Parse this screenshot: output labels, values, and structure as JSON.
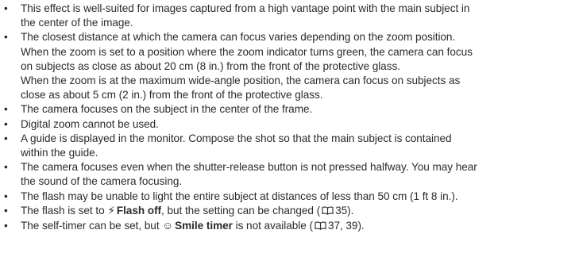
{
  "items": [
    {
      "lines": [
        "This effect is well-suited for images captured from a high vantage point with the main subject in",
        "the center of the image."
      ]
    },
    {
      "lines": [
        "The closest distance at which the camera can focus varies depending on the zoom position.",
        "When the zoom is set to a position where the zoom indicator turns green, the camera can focus",
        "on subjects as close as about 20 cm (8 in.) from the front of the protective glass.",
        "When the zoom is at the maximum wide-angle position, the camera can focus on subjects as",
        "close as about 5 cm (2 in.) from the front of the protective glass."
      ]
    },
    {
      "lines": [
        "The camera focuses on the subject in the center of the frame."
      ]
    },
    {
      "lines": [
        "Digital zoom cannot be used."
      ]
    },
    {
      "lines": [
        "A guide is displayed in the monitor. Compose the shot so that the main subject is contained",
        "within the guide."
      ]
    },
    {
      "lines": [
        "The camera focuses even when the shutter-release button is not pressed halfway. You may hear",
        "the sound of the camera focusing."
      ]
    },
    {
      "lines": [
        "The flash may be unable to light the entire subject at distances of less than 50 cm (1 ft 8 in.)."
      ]
    }
  ],
  "flash_item": {
    "pre": "The flash is set to",
    "glyph": "⚡",
    "bold": "Flash off",
    "mid": ", but the setting can be changed (",
    "ref": "35",
    "post": ")."
  },
  "timer_item": {
    "pre": "The self-timer can be set, but",
    "glyph": "☺",
    "bold": "Smile timer",
    "mid": "is not available (",
    "ref": "37, 39",
    "post": ")."
  },
  "bullet_char": "•"
}
